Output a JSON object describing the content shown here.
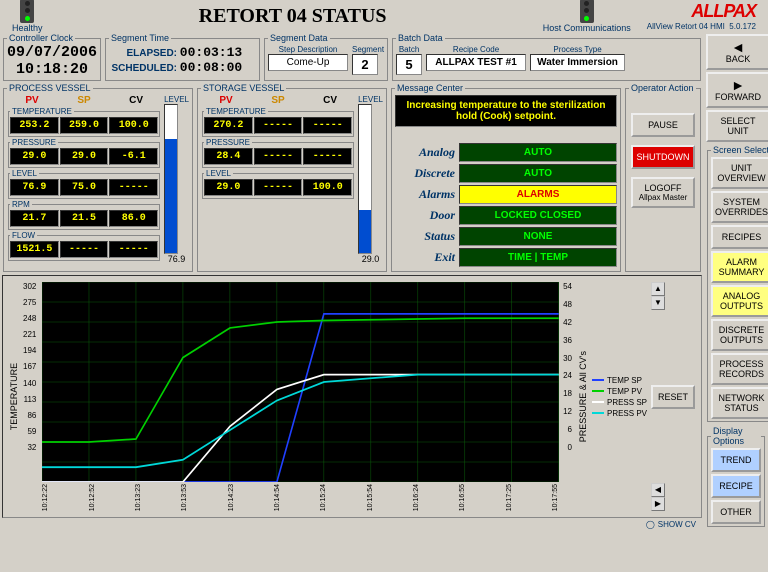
{
  "header": {
    "healthy": "Healthy",
    "title": "RETORT 04 STATUS",
    "hostcomm": "Host Communications",
    "product": "AllView Retort 04 HMI",
    "version": "5.0.172",
    "logo": "ALLPAX"
  },
  "clock": {
    "legend": "Controller Clock",
    "date": "09/07/2006",
    "time": "10:18:20"
  },
  "segtime": {
    "legend": "Segment Time",
    "elapsed_lbl": "ELAPSED:",
    "elapsed": "00:03:13",
    "sched_lbl": "SCHEDULED:",
    "sched": "00:08:00"
  },
  "segdata": {
    "legend": "Segment Data",
    "step_lbl": "Step Description",
    "step": "Come-Up",
    "seg_lbl": "Segment",
    "seg": "2"
  },
  "batchdata": {
    "legend": "Batch Data",
    "batch_lbl": "Batch",
    "batch": "5",
    "recipe_lbl": "Recipe Code",
    "recipe": "ALLPAX TEST #1",
    "ptype_lbl": "Process Type",
    "ptype": "Water Immersion"
  },
  "pvessel": {
    "legend": "PROCESS VESSEL",
    "pv": "PV",
    "sp": "SP",
    "cv": "CV",
    "level_lbl": "LEVEL",
    "groups": [
      {
        "lbl": "TEMPERATURE",
        "pv": "253.2",
        "sp": "259.0",
        "cv": "100.0"
      },
      {
        "lbl": "PRESSURE",
        "pv": "29.0",
        "sp": "29.0",
        "cv": "-6.1"
      },
      {
        "lbl": "LEVEL",
        "pv": "76.9",
        "sp": "75.0",
        "cv": "-----"
      },
      {
        "lbl": "RPM",
        "pv": "21.7",
        "sp": "21.5",
        "cv": "86.0"
      },
      {
        "lbl": "FLOW",
        "pv": "1521.5",
        "sp": "-----",
        "cv": "-----"
      }
    ],
    "bar_pct": 76.9,
    "bar_val": "76.9"
  },
  "svessel": {
    "legend": "STORAGE VESSEL",
    "pv": "PV",
    "sp": "SP",
    "cv": "CV",
    "level_lbl": "LEVEL",
    "groups": [
      {
        "lbl": "TEMPERATURE",
        "pv": "270.2",
        "sp": "-----",
        "cv": "-----"
      },
      {
        "lbl": "PRESSURE",
        "pv": "28.4",
        "sp": "-----",
        "cv": "-----"
      },
      {
        "lbl": "LEVEL",
        "pv": "29.0",
        "sp": "-----",
        "cv": "100.0"
      }
    ],
    "bar_pct": 29.0,
    "bar_val": "29.0"
  },
  "msgcenter": {
    "legend": "Message Center",
    "msg": "Increasing temperature to the sterilization hold (Cook) setpoint.",
    "rows": [
      {
        "lbl": "Analog",
        "val": "AUTO",
        "cls": ""
      },
      {
        "lbl": "Discrete",
        "val": "AUTO",
        "cls": ""
      },
      {
        "lbl": "Alarms",
        "val": "ALARMS",
        "cls": "yellow"
      },
      {
        "lbl": "Door",
        "val": "LOCKED CLOSED",
        "cls": ""
      },
      {
        "lbl": "Status",
        "val": "NONE",
        "cls": ""
      },
      {
        "lbl": "Exit",
        "val": "TIME | TEMP",
        "cls": ""
      }
    ]
  },
  "opaction": {
    "legend": "Operator Action",
    "pause": "PAUSE",
    "shutdown": "SHUTDOWN",
    "logoff": "LOGOFF",
    "logoff_sub": "Allpax Master"
  },
  "nav": {
    "back": "BACK",
    "forward": "FORWARD",
    "select_unit": "SELECT UNIT"
  },
  "screens": {
    "legend": "Screen Select",
    "items": [
      "UNIT OVERVIEW",
      "SYSTEM OVERRIDES",
      "RECIPES",
      "ALARM SUMMARY",
      "ANALOG OUTPUTS",
      "DISCRETE OUTPUTS",
      "PROCESS RECORDS",
      "NETWORK STATUS"
    ]
  },
  "display": {
    "legend": "Display Options",
    "items": [
      "TREND",
      "RECIPE",
      "OTHER"
    ]
  },
  "reset": "RESET",
  "showcv": "SHOW CV",
  "chart_data": {
    "type": "line",
    "title": "",
    "xlabel": "",
    "ylabel_left": "TEMPERATURE",
    "ylabel_right": "PRESSURE & All CV's",
    "ylim_left": [
      32,
      302
    ],
    "ylim_right": [
      0,
      54
    ],
    "yticks_left": [
      32,
      59,
      86,
      113,
      140,
      167,
      194,
      221,
      248,
      275,
      302
    ],
    "yticks_right": [
      0,
      6,
      12,
      18,
      24,
      30,
      36,
      42,
      48,
      54
    ],
    "x": [
      "10:12:22",
      "10:12:52",
      "10:13:23",
      "10:13:53",
      "10:14:23",
      "10:14:54",
      "10:15:24",
      "10:15:54",
      "10:16:24",
      "10:16:55",
      "10:17:25",
      "10:17:55"
    ],
    "series": [
      {
        "name": "TEMP SP",
        "color": "#2040ff",
        "axis": "left",
        "values": [
          32,
          32,
          32,
          32,
          32,
          32,
          259,
          259,
          259,
          259,
          259,
          259
        ]
      },
      {
        "name": "TEMP PV",
        "color": "#00d000",
        "axis": "left",
        "values": [
          86,
          86,
          90,
          200,
          240,
          248,
          250,
          251,
          252,
          253,
          253,
          253
        ]
      },
      {
        "name": "PRESS SP",
        "color": "#ffffff",
        "axis": "right",
        "values": [
          0,
          0,
          0,
          0,
          15,
          25,
          29,
          29,
          29,
          29,
          29,
          29
        ]
      },
      {
        "name": "PRESS PV",
        "color": "#00d8d8",
        "axis": "right",
        "values": [
          4,
          4,
          4,
          6,
          14,
          22,
          27,
          28,
          29,
          29,
          29,
          29
        ]
      }
    ]
  }
}
